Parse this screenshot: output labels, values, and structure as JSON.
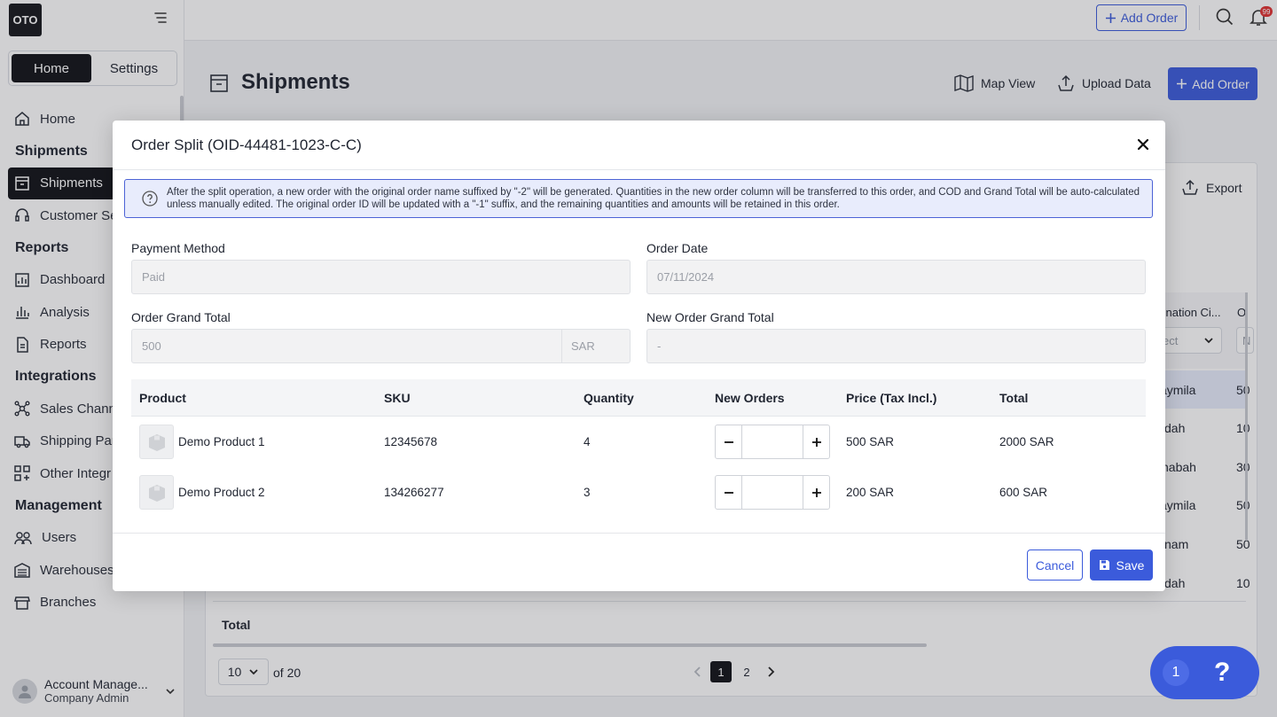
{
  "app": {
    "logo_text": "OTO"
  },
  "sidebar": {
    "tabs": [
      {
        "label": "Home"
      },
      {
        "label": "Settings"
      }
    ],
    "home_label": "Home",
    "sections": [
      {
        "title": "Shipments",
        "items": [
          {
            "label": "Shipments",
            "icon": "shipments-icon"
          },
          {
            "label": "Customer Se",
            "icon": "headset-icon"
          }
        ]
      },
      {
        "title": "Reports",
        "items": [
          {
            "label": "Dashboard",
            "icon": "dashboard-icon"
          },
          {
            "label": "Analysis",
            "icon": "analysis-icon"
          },
          {
            "label": "Reports",
            "icon": "reports-icon"
          }
        ]
      },
      {
        "title": "Integrations",
        "items": [
          {
            "label": "Sales Chann",
            "icon": "sales-channels-icon"
          },
          {
            "label": "Shipping Par",
            "icon": "truck-icon"
          },
          {
            "label": "Other Integr",
            "icon": "grid-plus-icon"
          }
        ]
      },
      {
        "title": "Management",
        "items": [
          {
            "label": "Users",
            "icon": "users-icon"
          },
          {
            "label": "Warehouses",
            "icon": "warehouse-icon"
          },
          {
            "label": "Branches",
            "icon": "store-icon"
          }
        ]
      }
    ],
    "account": {
      "name": "Account Manage...",
      "role": "Company Admin"
    }
  },
  "topbar": {
    "add_order_label": "Add Order",
    "notification_count": "99"
  },
  "page": {
    "title": "Shipments",
    "map_view_label": "Map View",
    "upload_data_label": "Upload Data",
    "add_order_label": "Add Order",
    "export_label": "Export",
    "bg_headers": [
      "tination Ci...",
      "O"
    ],
    "bg_select_placeholder": "ect",
    "bg_select2_placeholder": "N",
    "bg_rows": [
      [
        "aymila",
        "50"
      ],
      [
        "dah",
        "10"
      ],
      [
        "nabah",
        "30"
      ],
      [
        "aymila",
        "50"
      ],
      [
        "nam",
        "50"
      ],
      [
        "dah",
        "10"
      ]
    ],
    "total_label": "Total",
    "pager": {
      "page_size": "10",
      "of_label": "of 20",
      "pages": [
        "1",
        "2"
      ],
      "current_page": "1"
    },
    "help": {
      "count": "1",
      "symbol": "?"
    }
  },
  "modal": {
    "title": "Order Split (OID-44481-1023-C-C)",
    "info": "After the split operation, a new order with the original order name suffixed by \"-2\" will be generated. Quantities in the new order column will be transferred to this order, and COD and Grand Total will be auto-calculated unless manually edited. The original order ID will be updated with a \"-1\" suffix, and the remaining quantities and amounts will be retained in this order.",
    "fields": {
      "payment_method": {
        "label": "Payment Method",
        "value": "Paid"
      },
      "order_date": {
        "label": "Order Date",
        "value": "07/11/2024"
      },
      "order_grand_total": {
        "label": "Order Grand Total",
        "value": "500",
        "currency": "SAR"
      },
      "new_order_grand_total": {
        "label": "New Order Grand Total",
        "value": "-"
      }
    },
    "table": {
      "headers": [
        "Product",
        "SKU",
        "Quantity",
        "New Orders",
        "Price (Tax Incl.)",
        "Total"
      ],
      "rows": [
        {
          "product": "Demo Product 1",
          "sku": "12345678",
          "quantity": "4",
          "price": "500 SAR",
          "total": "2000 SAR"
        },
        {
          "product": "Demo Product 2",
          "sku": "134266277",
          "quantity": "3",
          "price": "200 SAR",
          "total": "600 SAR"
        }
      ]
    },
    "cancel_label": "Cancel",
    "save_label": "Save"
  }
}
